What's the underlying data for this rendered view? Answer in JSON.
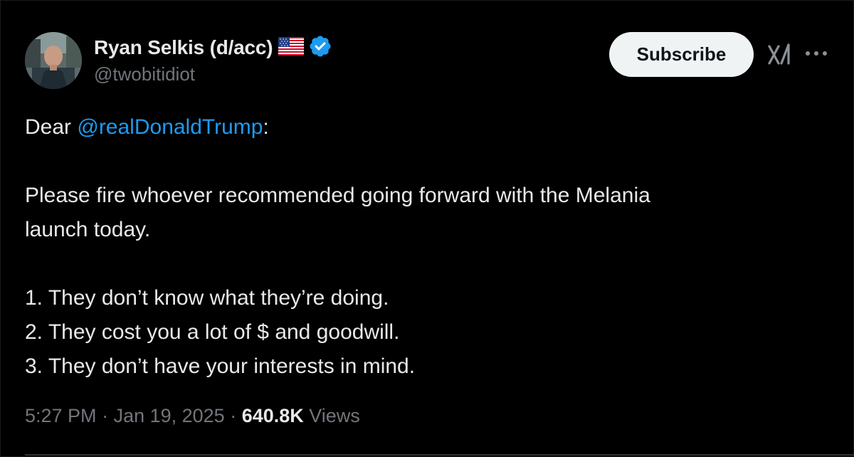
{
  "author": {
    "display_name": "Ryan Selkis (d/acc)",
    "handle": "@twobitidiot",
    "flag_icon": "us-flag-icon",
    "verified_icon": "verified-badge-icon",
    "verified_color": "#1d9bf0"
  },
  "actions": {
    "subscribe_label": "Subscribe",
    "grok_icon": "grok-icon",
    "more_icon": "more-options-icon"
  },
  "tweet": {
    "greeting_prefix": "Dear ",
    "mention": "@realDonaldTrump",
    "greeting_suffix": ":",
    "line_1": "Please fire whoever recommended going forward with the Melania",
    "line_2": "launch today.",
    "point_1": "1. They don’t know what they’re doing.",
    "point_2": "2. They cost you a lot of $ and goodwill.",
    "point_3": "3. They don’t have your interests in mind."
  },
  "meta": {
    "time": "5:27 PM",
    "separator": " · ",
    "date": "Jan 19, 2025",
    "views_count": "640.8K",
    "views_label": " Views"
  },
  "colors": {
    "background": "#000000",
    "text": "#e7e9ea",
    "secondary_text": "#71767b",
    "link": "#1d9bf0",
    "button_bg": "#eff3f4"
  }
}
